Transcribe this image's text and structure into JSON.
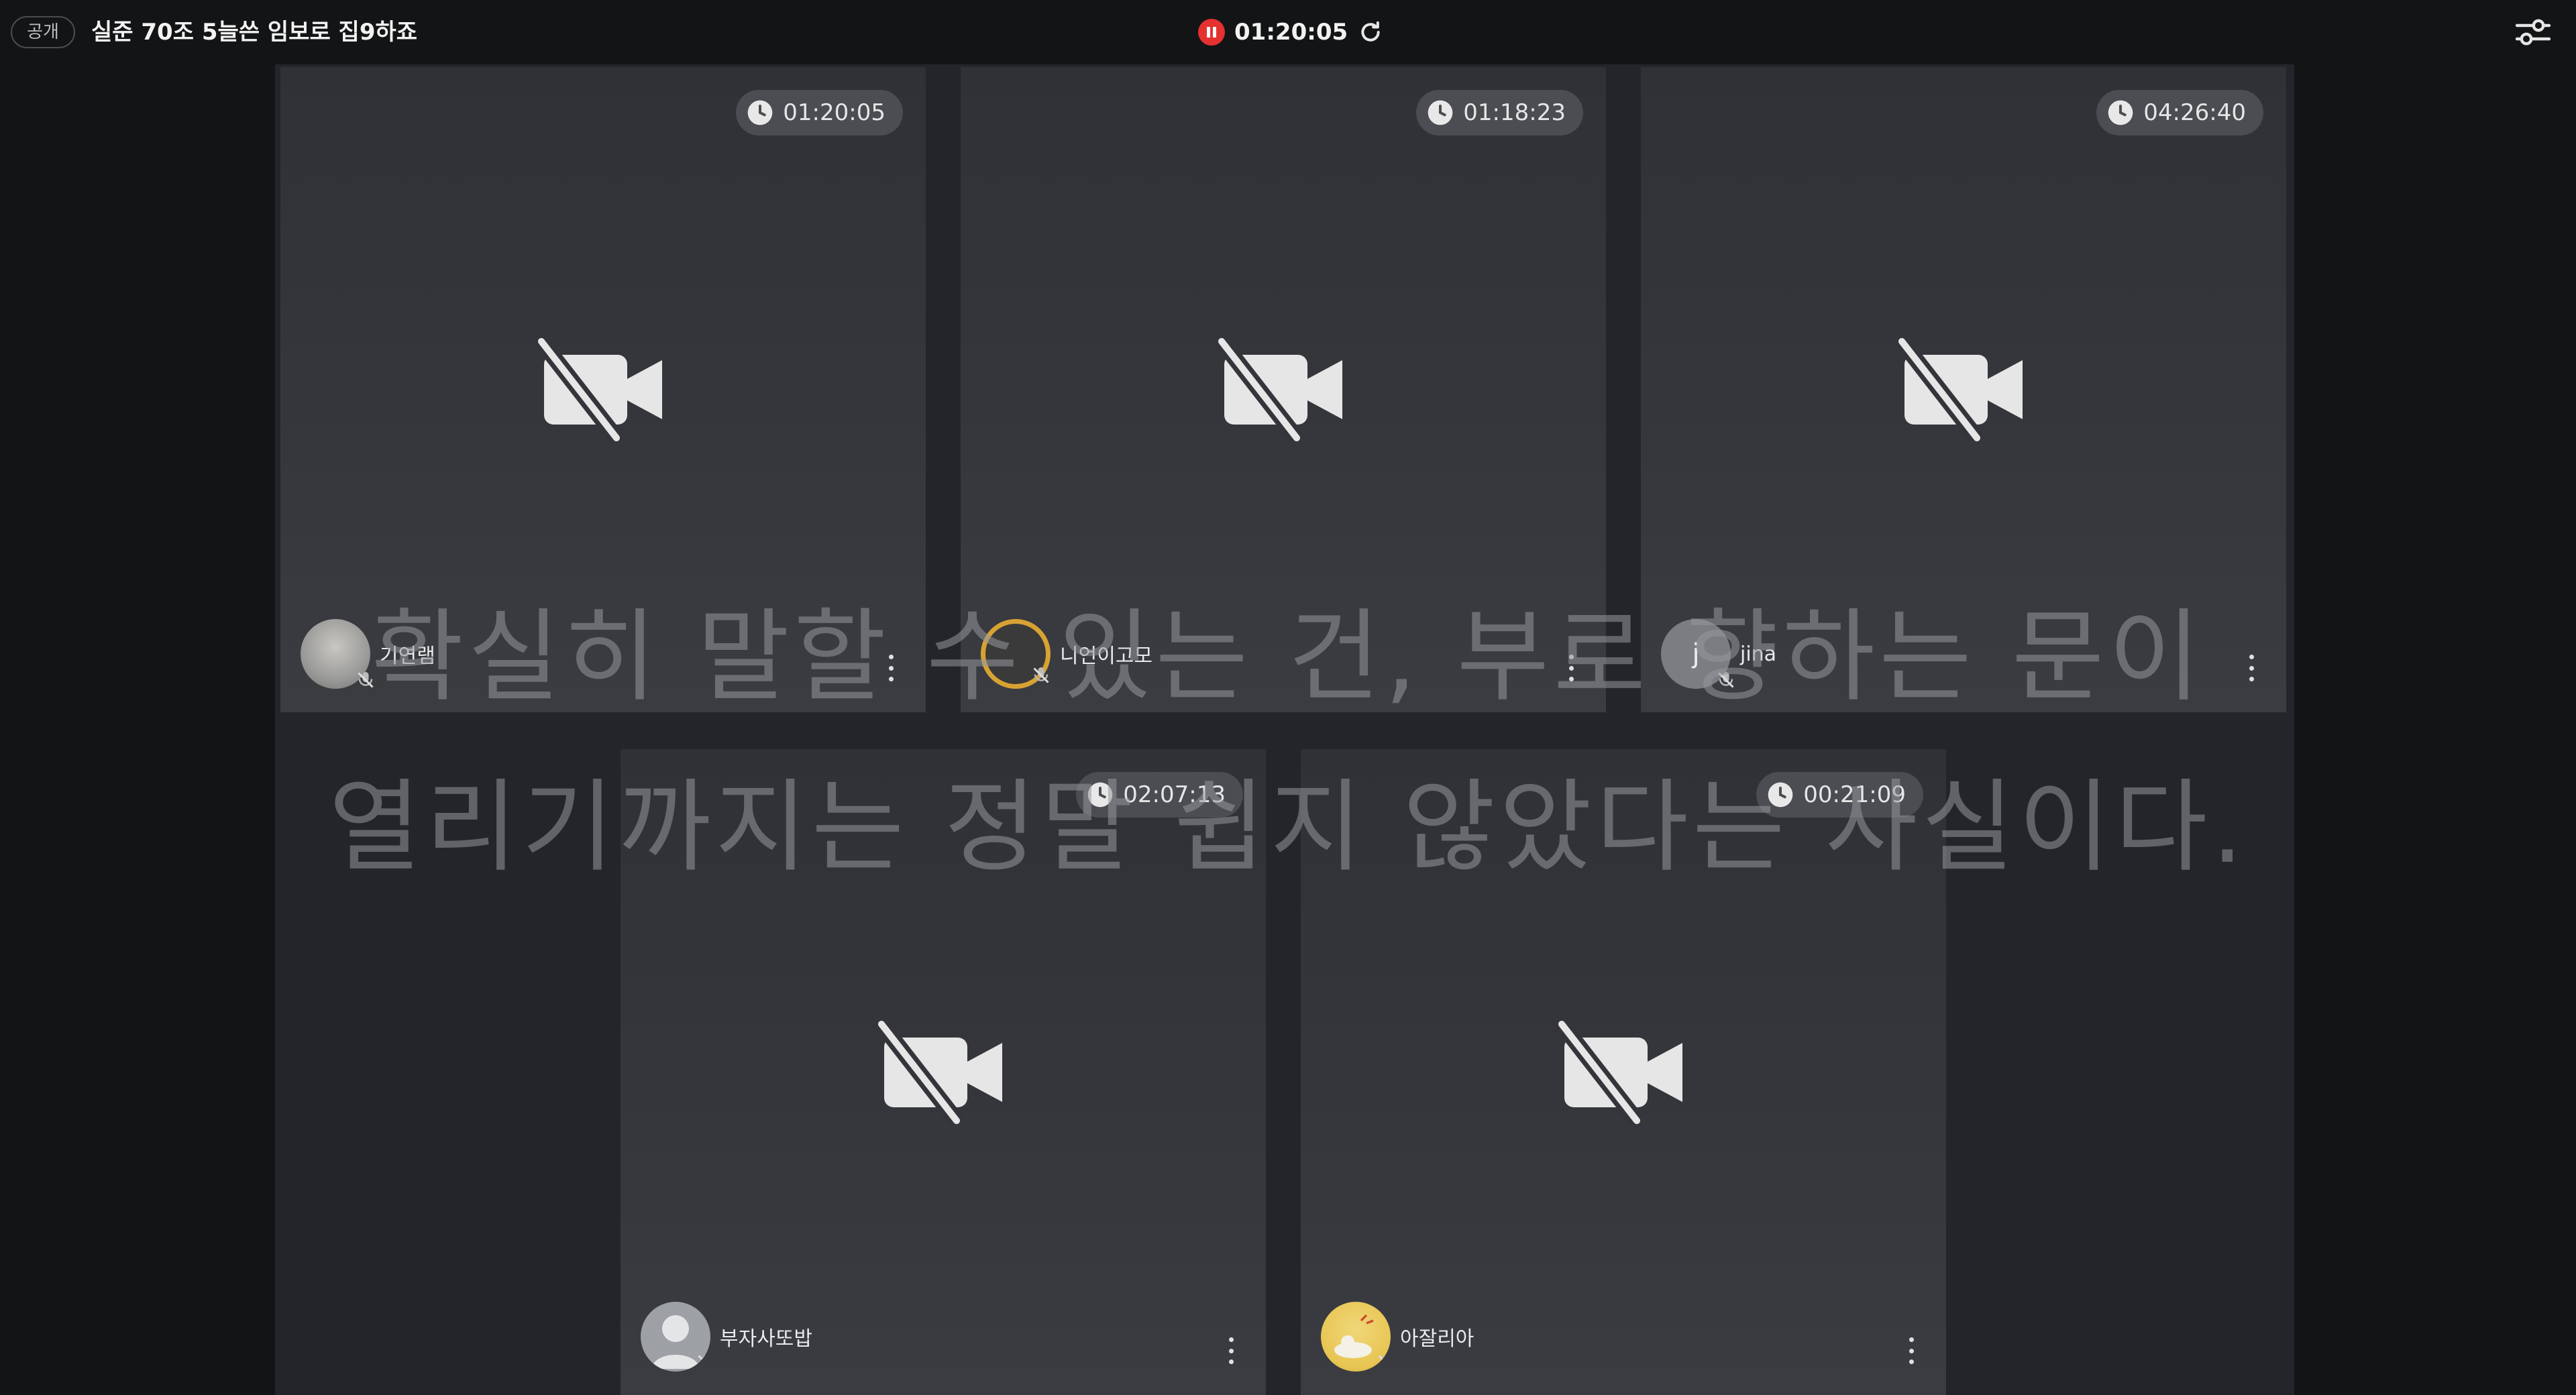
{
  "header": {
    "visibility_badge": "공개",
    "room_title": "실준 70조 5늘쓴 임보로 집9하죠",
    "record_time": "01:20:05",
    "record_color": "#e5312f"
  },
  "icons": {
    "record": "pause-record-icon",
    "refresh": "refresh-icon",
    "settings": "sliders-settings-icon",
    "camera_off": "camera-off-icon",
    "clock": "clock-icon",
    "mic_muted": "mic-muted-icon",
    "more": "kebab-menu-icon"
  },
  "participants": [
    {
      "name": "기연램",
      "timer": "01:20:05",
      "avatar": "photo-gray",
      "avatar_color": "#9a9a98"
    },
    {
      "name": "니언이고모",
      "timer": "01:18:23",
      "avatar": "character-ring",
      "avatar_color": "#d8a233"
    },
    {
      "name": "jina",
      "timer": "04:26:40",
      "avatar": "letter",
      "avatar_letter": "j",
      "avatar_color": "#7b7d82"
    },
    {
      "name": "부자사또밥",
      "timer": "02:07:13",
      "avatar": "default-person",
      "avatar_color": "#9da0a4"
    },
    {
      "name": "아잘리아",
      "timer": "00:21:09",
      "avatar": "illustration-yellow",
      "avatar_color": "#e8c552"
    }
  ],
  "subtitle": {
    "line1": "확실히 말할 수 있는 건, 부로 향하는 문이",
    "line2": "열리기까지는 정말 쉽지 않았다는 사실이다."
  }
}
